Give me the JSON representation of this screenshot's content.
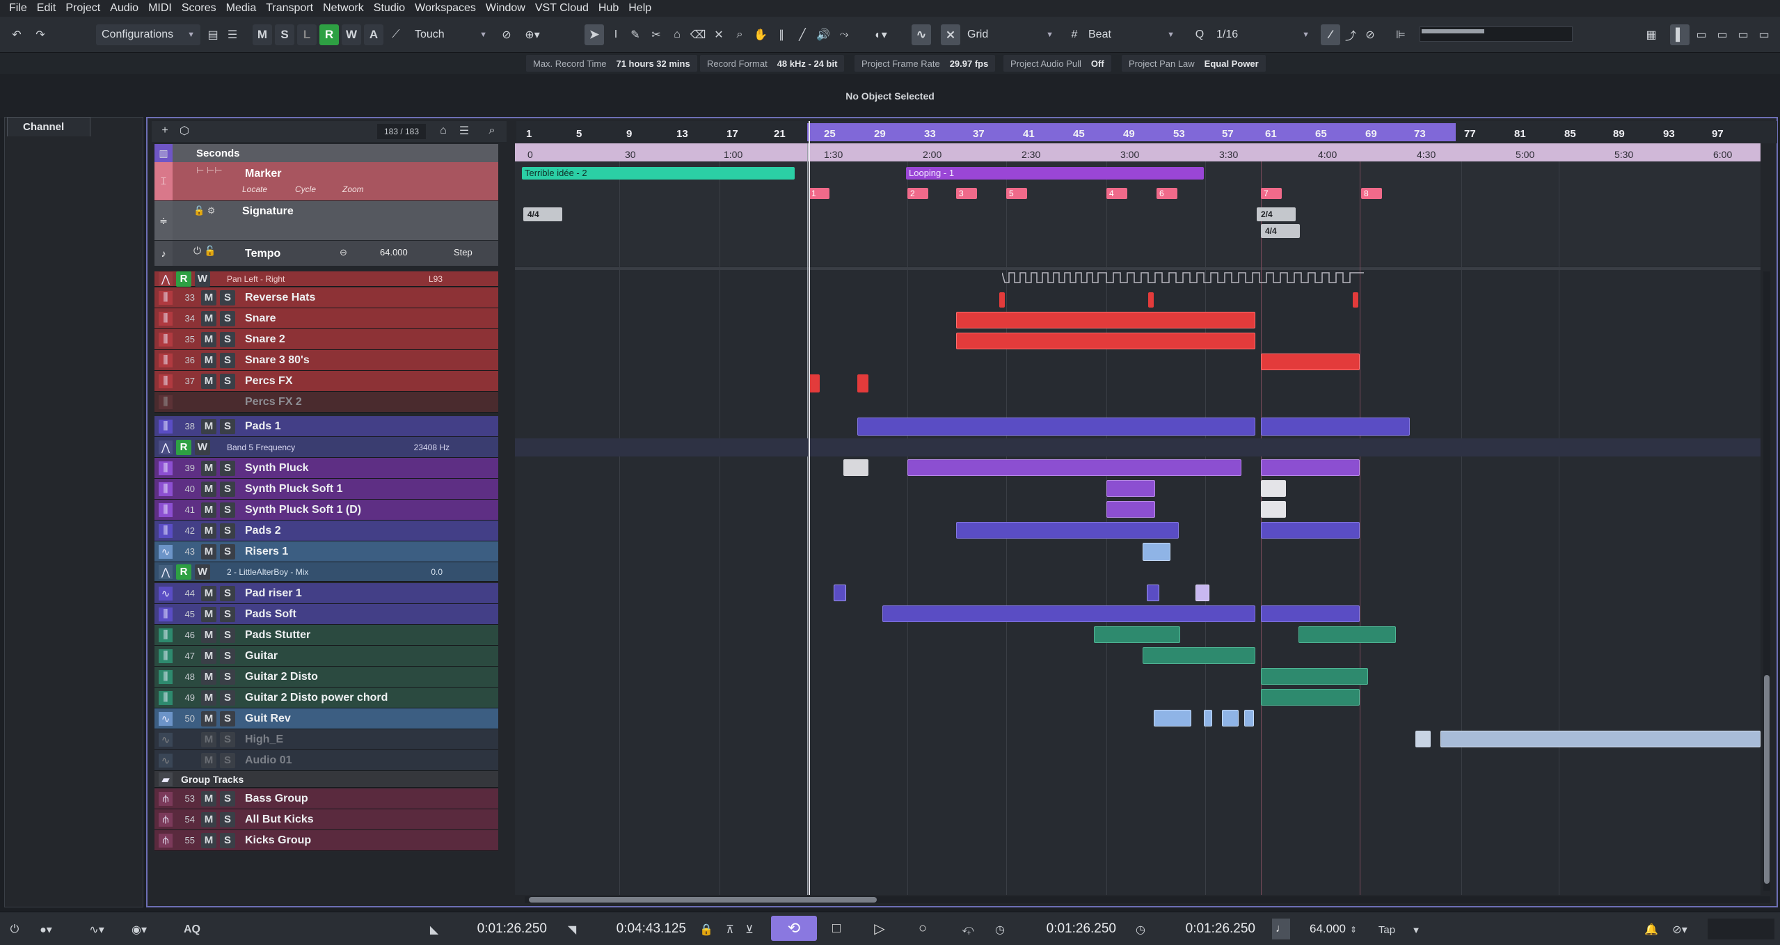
{
  "menu": [
    "File",
    "Edit",
    "Project",
    "Audio",
    "MIDI",
    "Scores",
    "Media",
    "Transport",
    "Network",
    "Studio",
    "Workspaces",
    "Window",
    "VST Cloud",
    "Hub",
    "Help"
  ],
  "toolbar": {
    "configurations": "Configurations",
    "automation_mode": "Touch",
    "snap_type": "Grid",
    "grid_type": "Beat",
    "quantize": "1/16",
    "mswra": [
      "M",
      "S",
      "L",
      "R",
      "W",
      "A"
    ]
  },
  "infobar": [
    {
      "label": "Max. Record Time",
      "value": "71 hours 32 mins"
    },
    {
      "label": "Record Format",
      "value": "48 kHz - 24 bit"
    },
    {
      "label": "Project Frame Rate",
      "value": "29.97 fps"
    },
    {
      "label": "Project Audio Pull",
      "value": "Off"
    },
    {
      "label": "Project Pan Law",
      "value": "Equal Power"
    }
  ],
  "status": "No Object Selected",
  "left_zone": {
    "tab": "Channel"
  },
  "track_counter": "183 / 183",
  "ruler": {
    "bars": [
      "1",
      "5",
      "9",
      "13",
      "17",
      "21",
      "25",
      "29",
      "33",
      "37",
      "41",
      "45",
      "49",
      "53",
      "57",
      "61",
      "65",
      "69",
      "73",
      "77",
      "81",
      "85",
      "89",
      "93",
      "97"
    ],
    "seconds": [
      "0",
      "30",
      "1:00",
      "1:30",
      "2:00",
      "2:30",
      "3:00",
      "3:30",
      "4:00",
      "4:30",
      "5:00",
      "5:30",
      "6:00"
    ]
  },
  "global_tracks": {
    "seconds": "Seconds",
    "marker": {
      "name": "Marker",
      "locate": "Locate",
      "cycle": "Cycle",
      "zoom": "Zoom"
    },
    "signature": "Signature",
    "tempo": {
      "name": "Tempo",
      "value": "64.000",
      "mode": "Step"
    }
  },
  "automation_rows": [
    {
      "param": "Pan Left - Right",
      "value": "L93"
    },
    {
      "param": "Band 5 Frequency",
      "value": "23408 Hz"
    },
    {
      "param": "2 - LittleAlterBoy - Mix",
      "value": "0.0"
    }
  ],
  "tracks": [
    {
      "num": "33",
      "name": "Reverse Hats"
    },
    {
      "num": "34",
      "name": "Snare"
    },
    {
      "num": "35",
      "name": "Snare 2"
    },
    {
      "num": "36",
      "name": "Snare 3 80's"
    },
    {
      "num": "37",
      "name": "Percs FX"
    },
    {
      "num": "",
      "name": "Percs FX 2"
    },
    {
      "num": "38",
      "name": "Pads 1"
    },
    {
      "num": "39",
      "name": "Synth Pluck"
    },
    {
      "num": "40",
      "name": "Synth Pluck Soft 1"
    },
    {
      "num": "41",
      "name": "Synth Pluck Soft 1 (D)"
    },
    {
      "num": "42",
      "name": "Pads 2"
    },
    {
      "num": "43",
      "name": "Risers 1"
    },
    {
      "num": "44",
      "name": "Pad riser 1"
    },
    {
      "num": "45",
      "name": "Pads Soft"
    },
    {
      "num": "46",
      "name": "Pads Stutter"
    },
    {
      "num": "47",
      "name": "Guitar"
    },
    {
      "num": "48",
      "name": "Guitar 2 Disto"
    },
    {
      "num": "49",
      "name": "Guitar 2 Disto  power chord"
    },
    {
      "num": "50",
      "name": "Guit Rev"
    },
    {
      "num": "",
      "name": "High_E"
    },
    {
      "num": "",
      "name": "Audio 01"
    },
    {
      "num": "",
      "name": "Group Tracks"
    },
    {
      "num": "53",
      "name": "Bass Group"
    },
    {
      "num": "54",
      "name": "All But Kicks"
    },
    {
      "num": "55",
      "name": "Kicks Group"
    }
  ],
  "markers": {
    "ranges": [
      "Terrible idée -  2",
      "Looping -  1"
    ],
    "numbers": [
      "1",
      "2",
      "3",
      "5",
      "4",
      "6",
      "7",
      "8"
    ],
    "signatures": [
      "4/4",
      "2/4",
      "4/4"
    ]
  },
  "transport": {
    "left_locator": "0:01:26.250",
    "right_locator": "0:04:43.125",
    "position": "0:01:26.250",
    "secondary": "0:01:26.250",
    "tempo": "64.000",
    "tap": "Tap",
    "aq": "AQ"
  },
  "colors": {
    "accent": "#7a66d8",
    "red": "#e33b3b",
    "purple": "#8c4fd1",
    "indigo": "#5a4dc4",
    "teal": "#2e8a6e",
    "lightblue": "#8fb4e6",
    "group": "#7b3a5a"
  }
}
